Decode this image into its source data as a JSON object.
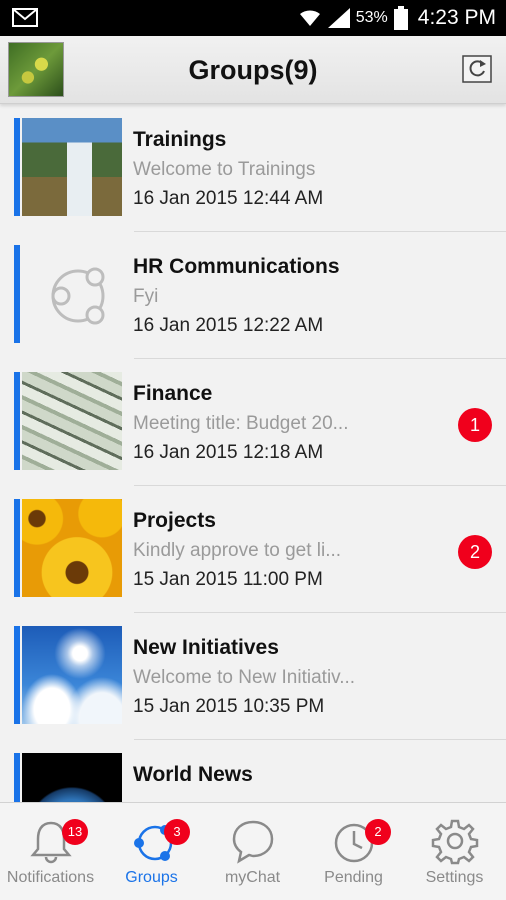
{
  "status_bar": {
    "battery_percent": "53%",
    "time": "4:23 PM",
    "icons": [
      "gmail-icon",
      "wifi-icon",
      "signal-icon",
      "battery-icon"
    ]
  },
  "header": {
    "title": "Groups(9)",
    "avatar_icon": "profile-avatar",
    "refresh_icon": "refresh-icon"
  },
  "groups": [
    {
      "name": "Trainings",
      "preview": "Welcome to Trainings",
      "time": "16 Jan 2015 12:44 AM",
      "badge": "",
      "thumb": "waterfall-image"
    },
    {
      "name": "HR Communications",
      "preview": "Fyi",
      "time": "16 Jan 2015 12:22 AM",
      "badge": "",
      "thumb": "group-placeholder-icon"
    },
    {
      "name": "Finance",
      "preview": "Meeting title: Budget 20...",
      "time": "16 Jan 2015 12:18 AM",
      "badge": "1",
      "thumb": "money-image"
    },
    {
      "name": "Projects",
      "preview": "Kindly approve to get li...",
      "time": "15 Jan 2015 11:00 PM",
      "badge": "2",
      "thumb": "sunflower-image"
    },
    {
      "name": "New Initiatives",
      "preview": "Welcome to New Initiativ...",
      "time": "15 Jan 2015 10:35 PM",
      "badge": "",
      "thumb": "sky-image"
    },
    {
      "name": "World News",
      "preview": "",
      "time": "",
      "badge": "",
      "thumb": "earth-image"
    }
  ],
  "tabs": [
    {
      "label": "Notifications",
      "badge": "13",
      "icon": "bell-icon",
      "active": false
    },
    {
      "label": "Groups",
      "badge": "3",
      "icon": "groups-icon",
      "active": true
    },
    {
      "label": "myChat",
      "badge": "",
      "icon": "chat-icon",
      "active": false
    },
    {
      "label": "Pending",
      "badge": "2",
      "icon": "clock-icon",
      "active": false
    },
    {
      "label": "Settings",
      "badge": "",
      "icon": "gear-icon",
      "active": false
    }
  ],
  "colors": {
    "accent": "#1a73e8",
    "badge": "#f0001c"
  }
}
